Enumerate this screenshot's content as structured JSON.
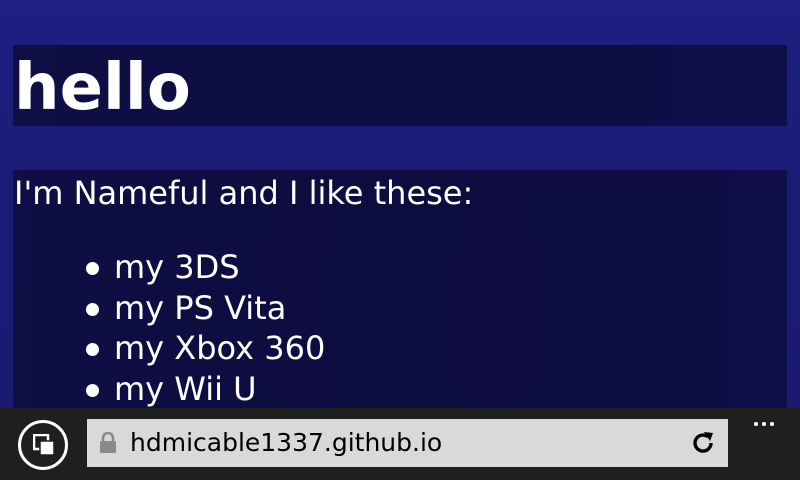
{
  "page": {
    "heading": "hello",
    "intro": "I'm Nameful and I like these:",
    "likes": [
      {
        "label": "my 3DS"
      },
      {
        "label": "my PS Vita"
      },
      {
        "label": "my Xbox 360"
      },
      {
        "label": "my Wii U"
      }
    ]
  },
  "browser": {
    "url": "hdmicable1337.github.io",
    "tabs_icon": "tabs-icon",
    "lock_icon": "lock-icon",
    "refresh_icon": "refresh-icon",
    "more_icon": "more-icon"
  },
  "colors": {
    "page_background": "#1c1f7e",
    "box_background": "#0e0d42",
    "browser_bar": "#1f1f1f",
    "address_bar": "#d9d9d9",
    "text": "#ffffff"
  }
}
